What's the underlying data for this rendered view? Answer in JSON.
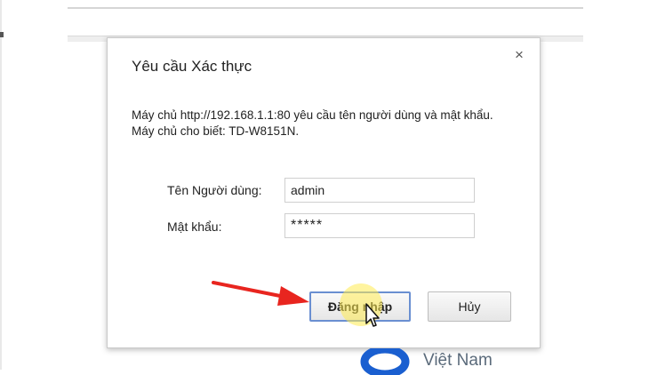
{
  "dialog": {
    "title": "Yêu cầu Xác thực",
    "close_glyph": "×",
    "message": "Máy chủ http://192.168.1.1:80 yêu cầu tên người dùng và mật khẩu. Máy chủ cho biết: TD-W8151N.",
    "username_label": "Tên Người dùng:",
    "username_value": "admin",
    "password_label": "Mật khẩu:",
    "password_value": "*****",
    "login_button": "Đăng nhập",
    "cancel_button": "Hủy"
  },
  "brand": {
    "text": "Việt Nam",
    "color": "#1a5fd0"
  },
  "icons": {
    "close": "close-icon",
    "arrow": "red-arrow-icon",
    "cursor": "mouse-cursor-icon",
    "logo": "brand-logo-icon"
  },
  "colors": {
    "arrow": "#e8251f",
    "highlight": "#ffeb50",
    "login_border": "#6a8fd1"
  }
}
